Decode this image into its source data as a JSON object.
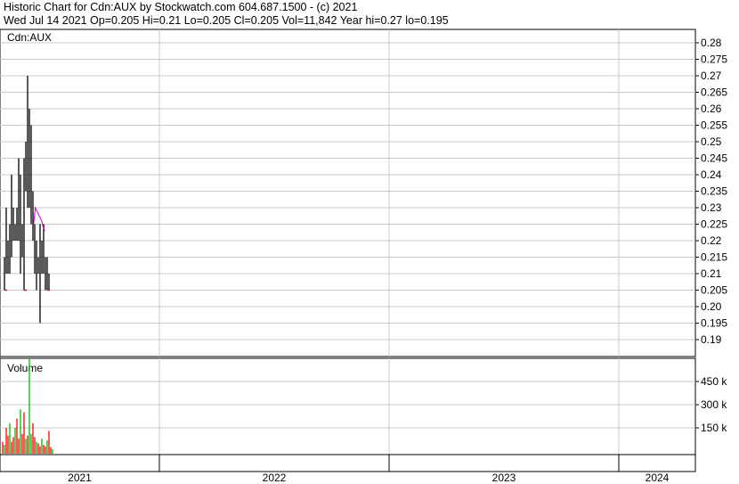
{
  "header": {
    "title_line": "Historic Chart for Cdn:AUX by Stockwatch.com 604.687.1500 - (c) 2021",
    "summary_line": "Wed Jul 14 2021  Op=0.205  Hi=0.21  Lo=0.205  Cl=0.205  Vol=11,842  Year hi=0.27  lo=0.195"
  },
  "colors": {
    "bar_black": "#000000",
    "mark_red": "#ff0000",
    "vol_green": "#00bb00",
    "ma_magenta": "#cc00cc",
    "grid": "#c8c8c8"
  },
  "chart_data": [
    {
      "type": "ohlc",
      "title": "Cdn:AUX",
      "ylim": [
        0.185,
        0.285
      ],
      "yticks": [
        0.28,
        0.275,
        0.27,
        0.265,
        0.26,
        0.255,
        0.25,
        0.245,
        0.24,
        0.235,
        0.23,
        0.225,
        0.22,
        0.215,
        0.21,
        0.205,
        0.2,
        0.195,
        0.19
      ],
      "ytick_labels": [
        "0.28",
        "0.275",
        "0.27",
        "0.265",
        "0.26",
        "0.255",
        "0.25",
        "0.245",
        "0.24",
        "0.235",
        "0.23",
        "0.225",
        "0.22",
        "0.215",
        "0.21",
        "0.205",
        "0.20",
        "0.195",
        "0.19"
      ],
      "xlabels": [
        "2021",
        "2022",
        "2023",
        "2024"
      ],
      "series": [
        {
          "kind": "price",
          "points": [
            {
              "hi": 0.215,
              "lo": 0.205
            },
            {
              "hi": 0.23,
              "lo": 0.21
            },
            {
              "hi": 0.22,
              "lo": 0.21
            },
            {
              "hi": 0.225,
              "lo": 0.21
            },
            {
              "hi": 0.24,
              "lo": 0.215
            },
            {
              "hi": 0.23,
              "lo": 0.22
            },
            {
              "hi": 0.225,
              "lo": 0.22
            },
            {
              "hi": 0.23,
              "lo": 0.22
            },
            {
              "hi": 0.245,
              "lo": 0.22
            },
            {
              "hi": 0.24,
              "lo": 0.21
            },
            {
              "hi": 0.225,
              "lo": 0.215
            },
            {
              "hi": 0.245,
              "lo": 0.205
            },
            {
              "hi": 0.25,
              "lo": 0.235
            },
            {
              "hi": 0.27,
              "lo": 0.23
            },
            {
              "hi": 0.26,
              "lo": 0.23
            },
            {
              "hi": 0.255,
              "lo": 0.225
            },
            {
              "hi": 0.235,
              "lo": 0.22
            },
            {
              "hi": 0.225,
              "lo": 0.21
            },
            {
              "hi": 0.22,
              "lo": 0.205
            },
            {
              "hi": 0.215,
              "lo": 0.21
            },
            {
              "hi": 0.225,
              "lo": 0.195
            },
            {
              "hi": 0.22,
              "lo": 0.21
            },
            {
              "hi": 0.225,
              "lo": 0.21
            },
            {
              "hi": 0.215,
              "lo": 0.205
            },
            {
              "hi": 0.215,
              "lo": 0.205
            },
            {
              "hi": 0.21,
              "lo": 0.205
            }
          ]
        },
        {
          "kind": "moving_average",
          "values": [
            0.225,
            0.23,
            0.229,
            0.228,
            0.227,
            0.226,
            0.224,
            0.223
          ]
        }
      ]
    },
    {
      "type": "bar",
      "title": "Volume",
      "ylim": [
        0,
        600
      ],
      "yticks": [
        450,
        300,
        150
      ],
      "ytick_labels": [
        "450 k",
        "300 k",
        "150 k"
      ],
      "series": [
        {
          "kind": "volume",
          "values": [
            60,
            40,
            150,
            100,
            180,
            60,
            90,
            150,
            210,
            80,
            270,
            110,
            250,
            80,
            100,
            610,
            110,
            180,
            90,
            60,
            50,
            30,
            80,
            40,
            30,
            70,
            130,
            25,
            12
          ]
        }
      ]
    }
  ]
}
